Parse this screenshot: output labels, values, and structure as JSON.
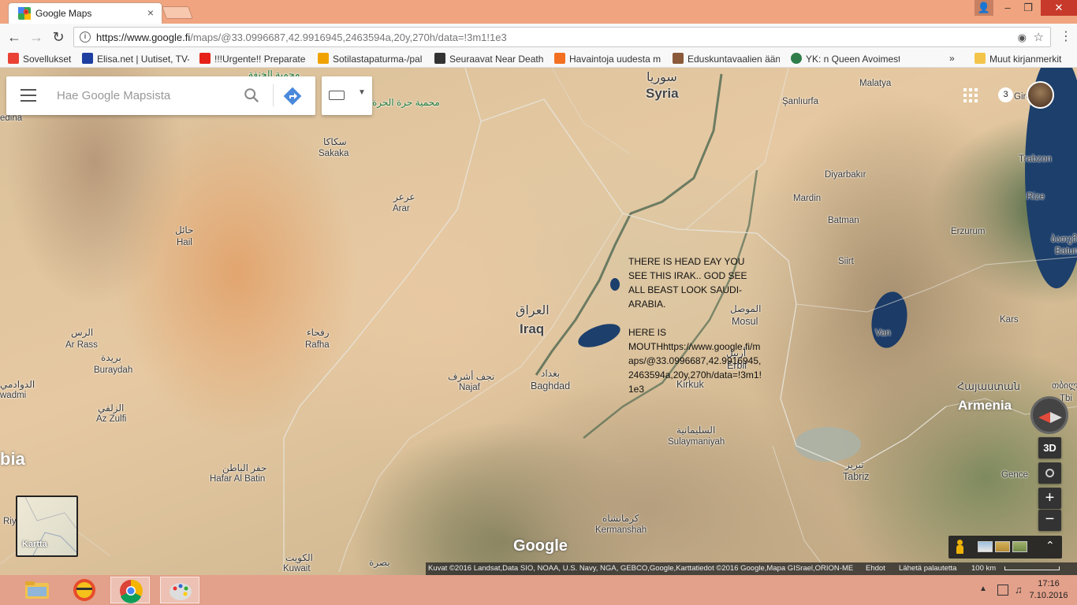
{
  "browser": {
    "tab_title": "Google Maps",
    "tab_close": "×",
    "url_host": "https://www.google.fi",
    "url_path": "/maps/@33.0996687,42.9916945,2463594a,20y,270h/data=!3m1!1e3",
    "window_buttons": {
      "user": "👤",
      "minimize": "–",
      "maximize": "❐",
      "close": "✕"
    },
    "bookmarks": [
      {
        "label": "Sovellukset",
        "color": "#e94235"
      },
      {
        "label": "Elisa.net | Uutiset, TV-",
        "color": "#1e3fa0"
      },
      {
        "label": "!!!Urgente!! Preparate",
        "color": "#e62117"
      },
      {
        "label": "Sotilastapaturma-/pal",
        "color": "#f0a300"
      },
      {
        "label": "Seuraavat Near Death",
        "color": "#333333"
      },
      {
        "label": "Havaintoja uudesta m",
        "color": "#f37020"
      },
      {
        "label": "Eduskuntavaalien ään",
        "color": "#8a5a3a"
      },
      {
        "label": "YK: n Queen Avoimest",
        "color": "#2f7d4a"
      }
    ],
    "bookmarks_more": "»",
    "other_bookmarks": "Muut kirjanmerkit"
  },
  "maps": {
    "search_placeholder": "Hae Google Mapsista",
    "notification_count": "3",
    "btn_3d": "3D",
    "zoom_in": "+",
    "zoom_out": "−",
    "minimap_label": "Kartta",
    "logo": "Google",
    "attribution": "Kuvat ©2016 Landsat,Data SIO, NOAA, U.S. Navy, NGA, GEBCO,Google,Karttatiedot ©2016 Google,Mapa GISrael,ORION-ME",
    "terms": "Ehdot",
    "feedback": "Lähetä palautetta",
    "scale": "100 km",
    "annotation": "THERE IS HEAD EAY YOU SEE THIS IRAK.. GOD SEE ALL BEAST LOOK SAUDI-ARABIA.\n\nHERE IS MOUTHhttps://www.google.fi/maps/@33.0996687,42.9916945,2463594a,20y,270h/data=!3m1!1e3"
  },
  "places": {
    "syria_ar": "سوريا",
    "syria": "Syria",
    "iraq_ar": "العراق",
    "iraq": "Iraq",
    "armenia_hy": "Հայաստան",
    "armenia": "Armenia",
    "medina": "edina",
    "sakaka_ar": "سكاكا",
    "sakaka": "Sakaka",
    "arar_ar": "عرعر",
    "arar": "Arar",
    "hail_ar": "حائل",
    "hail": "Hail",
    "ar_rass_ar": "الرس",
    "ar_rass": "Ar Rass",
    "buraydah_ar": "بريدة",
    "buraydah": "Buraydah",
    "az_zulfi_ar": "الزلفي",
    "az_zulfi": "Az Zulfi",
    "rafha_ar": "رفحاء",
    "rafha": "Rafha",
    "najaf_ar": "نجف أشرف",
    "najaf": "Najaf",
    "baghdad_ar": "بغداد",
    "baghdad": "Baghdad",
    "hafar_ar": "حفر الباطن",
    "hafar": "Hafar Al Batin",
    "kuwait_ar": "الكويت",
    "kuwait": "Kuwait",
    "basra_ar": "بصرة",
    "mosul_ar": "الموصل",
    "mosul": "Mosul",
    "erbil_ar": "أربيل",
    "erbil": "Erbil",
    "kirkuk": "Kirkuk",
    "sulaymaniyah_ar": "السليمانية",
    "sulaymaniyah": "Sulaymaniyah",
    "kermanshah_ar": "کرمانشاه",
    "kermanshah": "Kermanshah",
    "tabriz_ar": "تبریز",
    "tabriz": "Tabriz",
    "malatya": "Malatya",
    "sanliurfa": "Şanlıurfa",
    "diyarbakir": "Diyarbakır",
    "mardin": "Mardin",
    "batman": "Batman",
    "siirt": "Siirt",
    "van": "Van",
    "erzurum": "Erzurum",
    "kars": "Kars",
    "trabzon": "Trabzon",
    "rize": "Rize",
    "giresun_part": "Gire",
    "batumi_ka": "ბათუმი",
    "batumi_part": "Batum",
    "gence": "Gence",
    "tbilisi_ka": "თბილ",
    "tbilisi_part": "Tbi",
    "saudi_part": "bia",
    "riyadh_part": "Riy",
    "dawadmi_ar": "الدوادمي",
    "dawadmi_part": "wadmi",
    "green_reserve_ar": "محمية حرة الحرة",
    "green_reserve2_ar": "محمية الخنفة"
  },
  "taskbar": {
    "time": "17:16",
    "date": "7.10.2016"
  }
}
